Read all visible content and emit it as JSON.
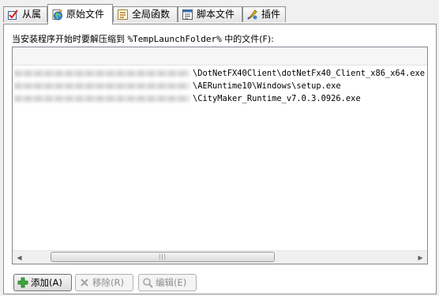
{
  "tabs": [
    {
      "label": "从属",
      "icon": "checkbox-check-icon",
      "active": false
    },
    {
      "label": "原始文件",
      "icon": "file-globe-icon",
      "active": true
    },
    {
      "label": "全局函数",
      "icon": "function-list-icon",
      "active": false
    },
    {
      "label": "脚本文件",
      "icon": "script-icon",
      "active": false
    },
    {
      "label": "插件",
      "icon": "plugin-pen-icon",
      "active": false
    }
  ],
  "prompt": {
    "before": "当安装程序开始时要解压缩到 ",
    "variable": "%TempLaunchFolder%",
    "after": " 中的文件(F):"
  },
  "files": [
    {
      "path": "\\DotNetFX40Client\\dotNetFx40_Client_x86_x64.exe"
    },
    {
      "path": "\\AERuntime10\\Windows\\setup.exe"
    },
    {
      "path": "\\CityMaker_Runtime_v7.0.3.0926.exe"
    }
  ],
  "scrollbar": {
    "grip": "|||"
  },
  "buttons": {
    "add": "添加(A)",
    "remove": "移除(R)",
    "edit": "编辑(E)"
  },
  "colors": {
    "accent_green": "#2a9a2a",
    "border": "#8e8f8f"
  }
}
